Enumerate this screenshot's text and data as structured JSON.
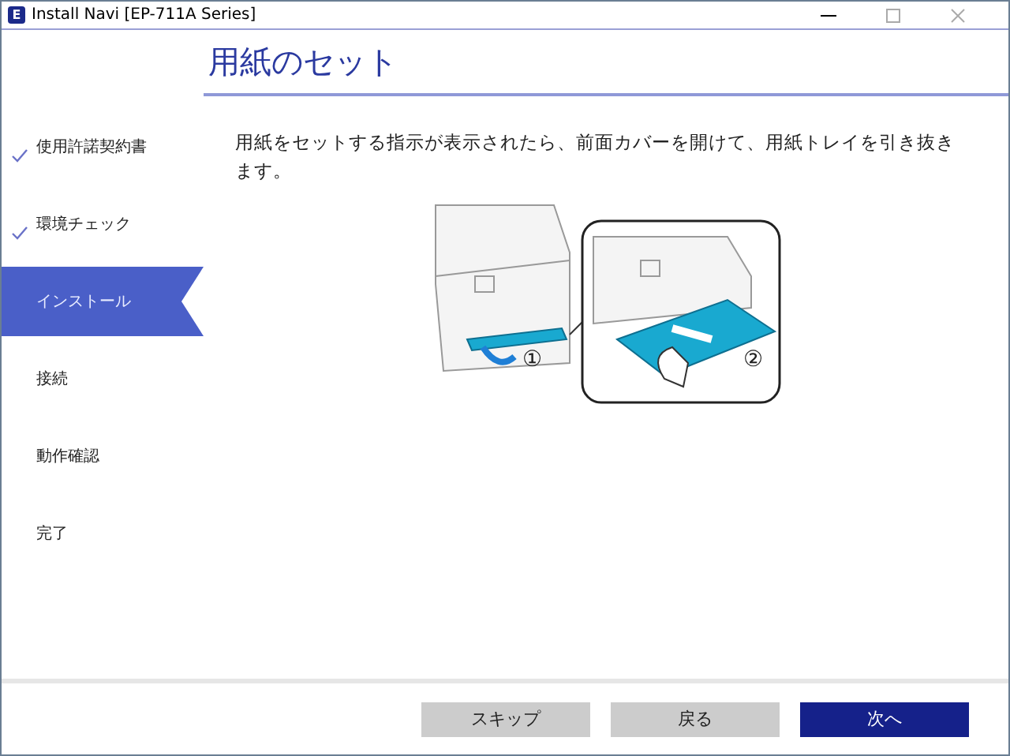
{
  "window": {
    "title": "Install Navi [EP-711A Series]",
    "app_icon": "E"
  },
  "steps": [
    {
      "label": "使用許諾契約書",
      "done": true,
      "selected": false
    },
    {
      "label": "環境チェック",
      "done": true,
      "selected": false
    },
    {
      "label": "インストール",
      "done": false,
      "selected": true
    },
    {
      "label": "接続",
      "done": false,
      "selected": false
    },
    {
      "label": "動作確認",
      "done": false,
      "selected": false
    },
    {
      "label": "完了",
      "done": false,
      "selected": false
    }
  ],
  "page": {
    "heading": "用紙のセット",
    "instruction": "用紙をセットする指示が表示されたら、前面カバーを開けて、用紙トレイを引き抜きます。",
    "figure_labels": [
      "①",
      "②"
    ]
  },
  "buttons": [
    {
      "label": "スキップ",
      "kind": "secondary"
    },
    {
      "label": "戻る",
      "kind": "secondary"
    },
    {
      "label": "次へ",
      "kind": "primary"
    }
  ]
}
